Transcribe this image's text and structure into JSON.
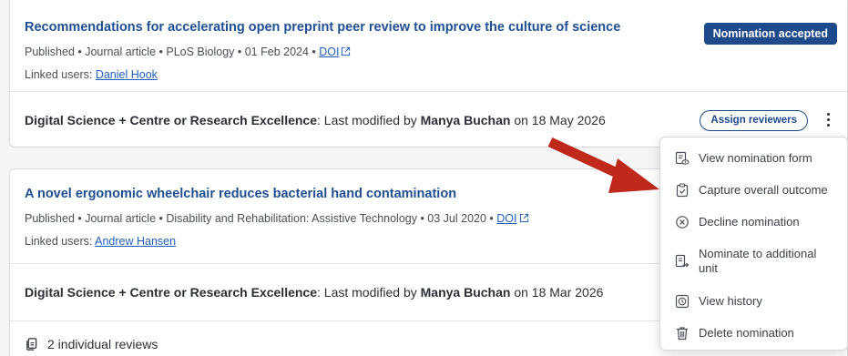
{
  "cards": [
    {
      "title": "Recommendations for accelerating open preprint peer review to improve the culture of science",
      "meta_prefix": "Published • Journal article • PLoS Biology • 01 Feb 2024 • ",
      "doi_label": "DOI",
      "linked_label": "Linked users: ",
      "linked_user": "Daniel Hook",
      "badge": "Nomination accepted",
      "foot_unit": "Digital Science + Centre or Research Excellence",
      "foot_mid": ": Last modified by ",
      "foot_user": "Manya Buchan",
      "foot_date": " on 18 May 2026",
      "assign_label": "Assign reviewers"
    },
    {
      "title": "A novel ergonomic wheelchair reduces bacterial hand contamination",
      "meta_prefix": "Published • Journal article • Disability and Rehabilitation: Assistive Technology • 03 Jul 2020 • ",
      "doi_label": "DOI",
      "linked_label": "Linked users: ",
      "linked_user": "Andrew Hansen",
      "foot_unit": "Digital Science + Centre or Research Excellence",
      "foot_mid": ": Last modified by ",
      "foot_user": "Manya Buchan",
      "foot_date": " on 18 Mar 2026",
      "reviews": "2 individual reviews"
    }
  ],
  "menu": {
    "items": [
      {
        "label": "View nomination form",
        "icon": "form-view-icon"
      },
      {
        "label": "Capture overall outcome",
        "icon": "clipboard-check-icon"
      },
      {
        "label": "Decline nomination",
        "icon": "circle-x-icon"
      },
      {
        "label": "Nominate to additional unit",
        "icon": "document-forward-icon"
      },
      {
        "label": "View history",
        "icon": "history-icon"
      },
      {
        "label": "Delete nomination",
        "icon": "trash-icon"
      }
    ]
  },
  "colors": {
    "title": "#1f4f93",
    "accent": "#1e4a8c",
    "link": "#1f5fbf",
    "annotation_arrow": "#c0281c"
  }
}
